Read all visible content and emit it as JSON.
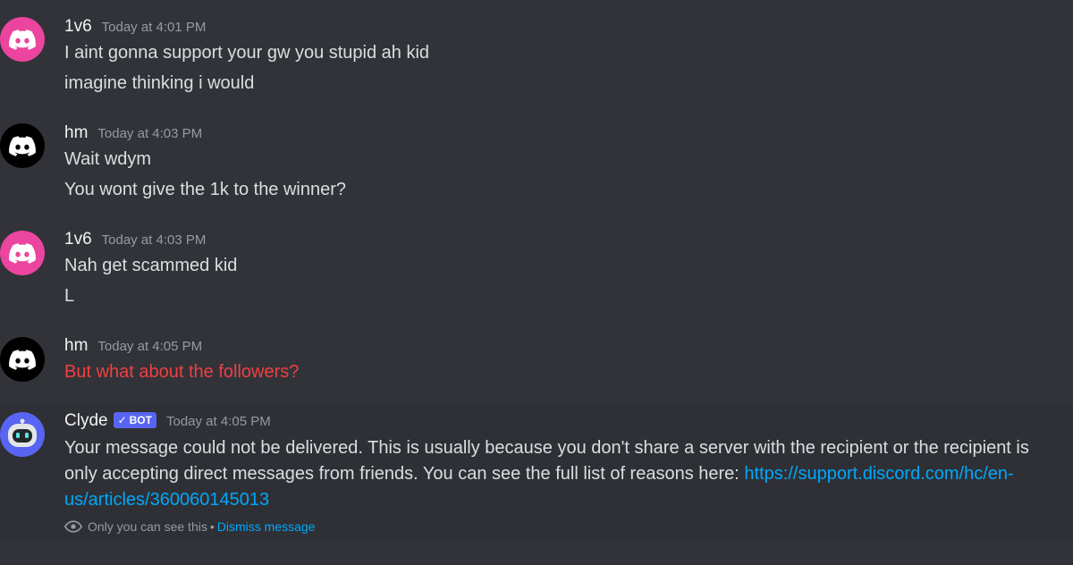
{
  "messages": [
    {
      "username": "1v6",
      "timestamp": "Today at 4:01 PM",
      "avatar": {
        "icon": "discord-logo-icon",
        "color": "#eb459f"
      },
      "lines": [
        "I aint gonna support your gw you stupid ah kid",
        "imagine thinking i would"
      ]
    },
    {
      "username": "hm",
      "timestamp": "Today at 4:03 PM",
      "avatar": {
        "icon": "discord-logo-icon",
        "color": "#000000"
      },
      "lines": [
        "Wait wdym",
        "You wont give the 1k to the winner?"
      ]
    },
    {
      "username": "1v6",
      "timestamp": "Today at 4:03 PM",
      "avatar": {
        "icon": "discord-logo-icon",
        "color": "#eb459f"
      },
      "lines": [
        "Nah get scammed kid",
        "L"
      ]
    },
    {
      "username": "hm",
      "timestamp": "Today at 4:05 PM",
      "avatar": {
        "icon": "discord-logo-icon",
        "color": "#000000"
      },
      "lines": [
        "But what about the followers?"
      ],
      "failed": true,
      "failed_color": "#f23f42"
    }
  ],
  "clyde": {
    "username": "Clyde",
    "badge": "BOT",
    "badge_icon": "checkmark-icon",
    "badge_color": "#5865f2",
    "timestamp": "Today at 4:05 PM",
    "avatar": {
      "icon": "clyde-robot-icon",
      "color": "#5865f2"
    },
    "text": "Your message could not be delivered. This is usually because you don't share a server with the recipient or the recipient is only accepting direct messages from friends. You can see the full list of reasons here: ",
    "link": "https://support.discord.com/hc/en-us/articles/360060145013",
    "link_color": "#00a8fc",
    "ephemeral_icon": "eye-icon",
    "ephemeral_note": "Only you can see this",
    "separator": "•",
    "dismiss_label": "Dismiss message"
  },
  "theme": {
    "background": "#313338",
    "highlight_background": "#2e3035",
    "text_color": "#dbdee1",
    "muted_color": "#949ba4"
  }
}
